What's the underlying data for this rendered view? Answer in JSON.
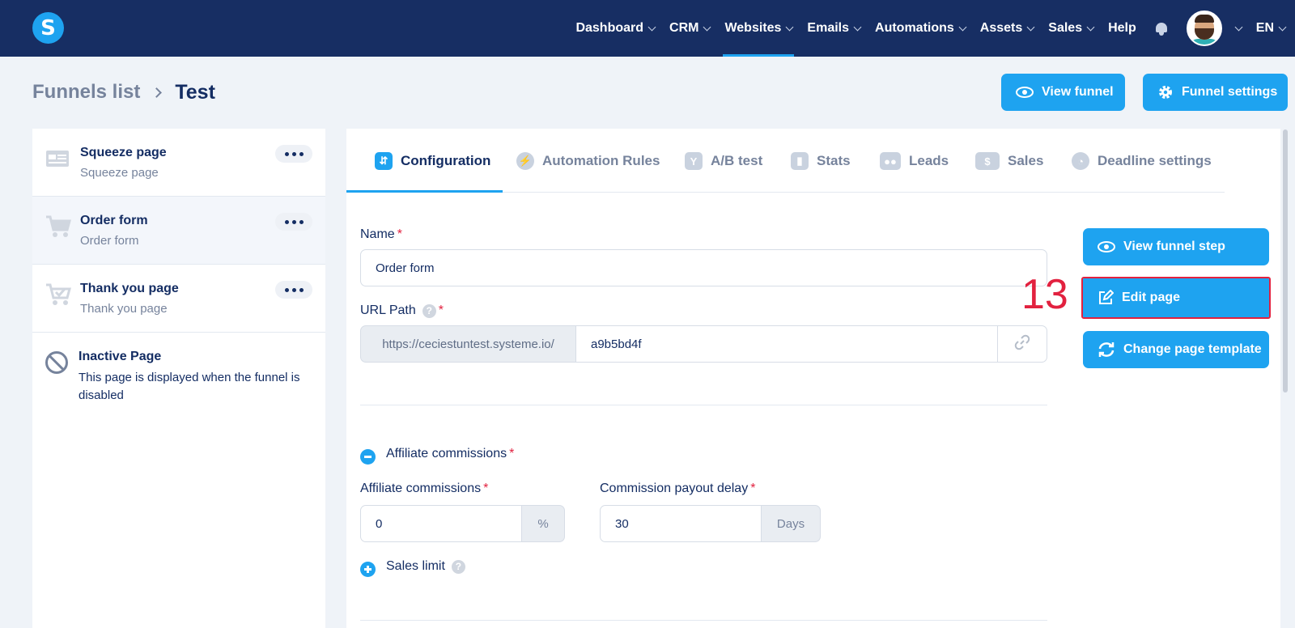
{
  "nav": {
    "logo": "S",
    "items": [
      {
        "label": "Dashboard",
        "dropdown": true
      },
      {
        "label": "CRM",
        "dropdown": true
      },
      {
        "label": "Websites",
        "dropdown": true,
        "active": true
      },
      {
        "label": "Emails",
        "dropdown": true
      },
      {
        "label": "Automations",
        "dropdown": true
      },
      {
        "label": "Assets",
        "dropdown": true
      },
      {
        "label": "Sales",
        "dropdown": true
      },
      {
        "label": "Help",
        "dropdown": false
      }
    ],
    "language": "EN"
  },
  "header": {
    "breadcrumb_root": "Funnels list",
    "breadcrumb_current": "Test",
    "view_funnel": "View funnel",
    "funnel_settings": "Funnel settings"
  },
  "sidebar": {
    "steps": [
      {
        "title": "Squeeze page",
        "sub": "Squeeze page",
        "icon": "squeeze-page-icon"
      },
      {
        "title": "Order form",
        "sub": "Order form",
        "icon": "cart-icon",
        "selected": true
      },
      {
        "title": "Thank you page",
        "sub": "Thank you page",
        "icon": "cart-check-icon"
      }
    ],
    "inactive": {
      "title": "Inactive Page",
      "desc": "This page is displayed when the funnel is disabled"
    }
  },
  "tabs": [
    {
      "label": "Configuration",
      "icon": "sliders-icon",
      "active": true
    },
    {
      "label": "Automation Rules",
      "icon": "bolt-icon"
    },
    {
      "label": "A/B test",
      "icon": "split-icon"
    },
    {
      "label": "Stats",
      "icon": "bar-chart-icon"
    },
    {
      "label": "Leads",
      "icon": "users-icon"
    },
    {
      "label": "Sales",
      "icon": "dollar-icon"
    },
    {
      "label": "Deadline settings",
      "icon": "clock-icon"
    }
  ],
  "form": {
    "name_label": "Name",
    "name_value": "Order form",
    "url_label": "URL Path",
    "url_prefix": "https://ceciestuntest.systeme.io/",
    "url_value": "a9b5bd4f",
    "affiliate_section": "Affiliate commissions",
    "affiliate_label": "Affiliate commissions",
    "affiliate_value": "0",
    "affiliate_unit": "%",
    "payout_label": "Commission payout delay",
    "payout_value": "30",
    "payout_unit": "Days",
    "sales_limit": "Sales limit",
    "required_mark": "*",
    "help_mark": "?"
  },
  "actions": {
    "view_step": "View funnel step",
    "edit_page": "Edit page",
    "change_template": "Change page template"
  },
  "annotation": "13",
  "colors": {
    "nav_bg": "#172e63",
    "accent": "#1ea3f0",
    "annotation_red": "#e2213f"
  }
}
